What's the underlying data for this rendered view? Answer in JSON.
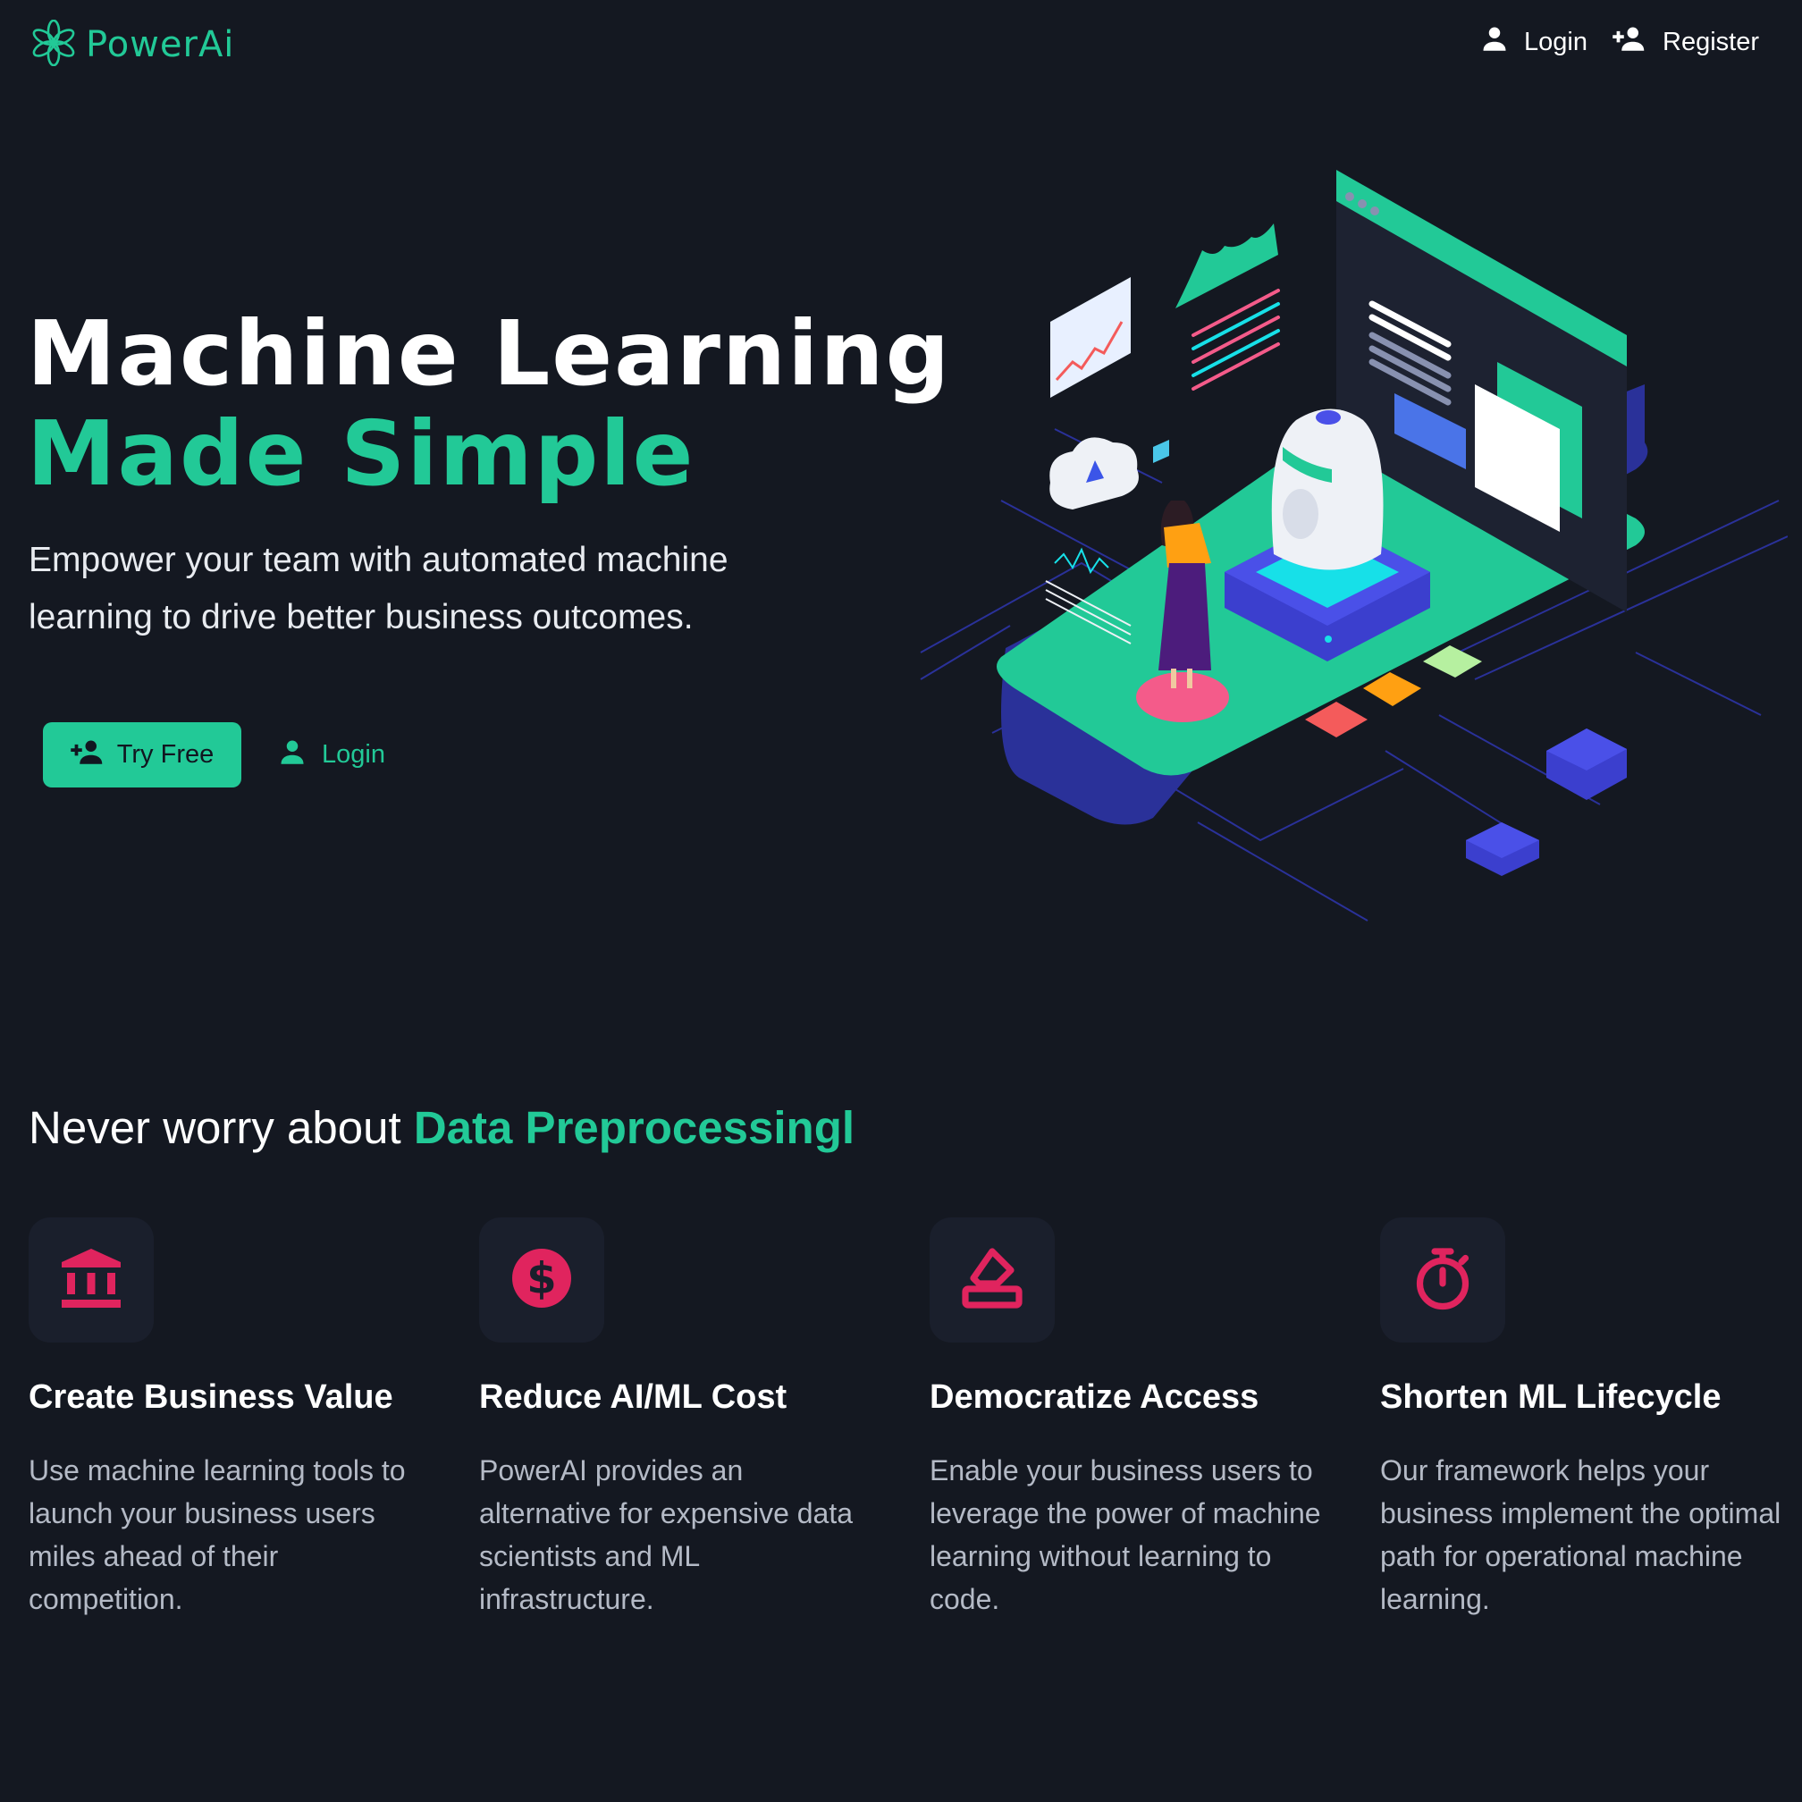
{
  "colors": {
    "background": "#141821",
    "accent": "#22c997",
    "feature_icon": "#e0245e",
    "feature_icon_bg": "#1a1f2c",
    "body_text": "#b4bac6"
  },
  "nav": {
    "brand": "PowerAi",
    "logo_icon": "flower-logo-icon",
    "login_label": "Login",
    "register_label": "Register",
    "login_icon": "user-icon",
    "register_icon": "user-plus-icon"
  },
  "hero": {
    "title_line1": "Machine Learning",
    "title_line2": "Made Simple",
    "subtitle_line1": "Empower your team with automated machine",
    "subtitle_line2": "learning to drive better business outcomes.",
    "try_free_label": "Try Free",
    "login_label": "Login",
    "illustration": "isometric-ml-platform-illustration"
  },
  "section": {
    "title_prefix": "Never worry about ",
    "title_accent": "Data Preprocessingl"
  },
  "features": [
    {
      "icon": "bank-icon",
      "title": "Create Business Value",
      "description": "Use machine learning tools to launch your business users miles ahead of their competition."
    },
    {
      "icon": "dollar-circle-icon",
      "title": "Reduce AI/ML Cost",
      "description": "PowerAI provides an alternative for expensive data scientists and ML infrastructure."
    },
    {
      "icon": "eraser-icon",
      "title": "Democratize Access",
      "description": "Enable your business users to leverage the power of machine learning without learning to code."
    },
    {
      "icon": "stopwatch-icon",
      "title": "Shorten ML Lifecycle",
      "description": "Our framework helps your business implement the optimal path for operational machine learning."
    }
  ]
}
